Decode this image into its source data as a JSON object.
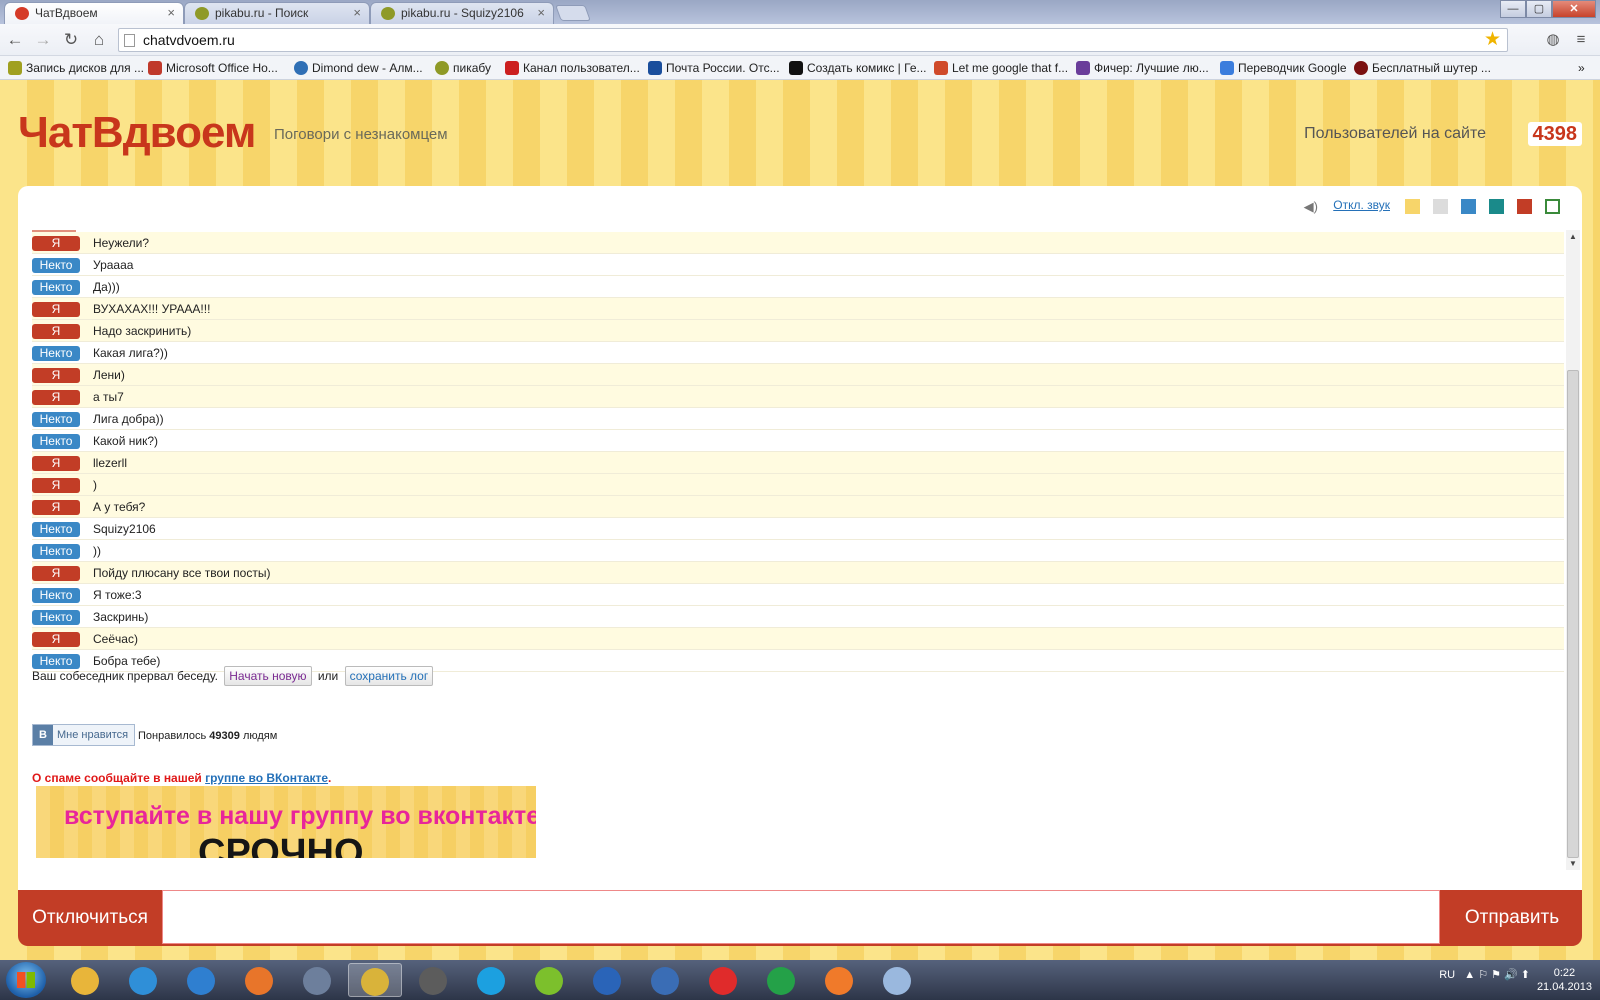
{
  "browser": {
    "tabs": [
      {
        "label": "ЧатВдвоем",
        "active": true,
        "favicon_color": "#d53b28"
      },
      {
        "label": "pikabu.ru - Поиск",
        "active": false,
        "favicon_color": "#8f9a27"
      },
      {
        "label": "pikabu.ru - Squizy2106",
        "active": false,
        "favicon_color": "#8f9a27"
      }
    ],
    "close_glyph": "×",
    "window_controls": {
      "minimize": "—",
      "maximize": "▢",
      "close": "✕"
    },
    "nav": {
      "back": "←",
      "forward": "→",
      "reload": "↻",
      "home": "⌂"
    },
    "address": "chatvdvoem.ru",
    "bookmarks": [
      {
        "label": "Запись дисков для ...",
        "icon_color": "#a0a020"
      },
      {
        "label": "Microsoft Office Но...",
        "icon_color": "#c0392b"
      },
      {
        "label": "Dimond dew - Алм...",
        "icon_color": "#2f6fb5"
      },
      {
        "label": "пикабу",
        "icon_color": "#8f9a27"
      },
      {
        "label": "Канал пользовател...",
        "icon_color": "#cc1f1f"
      },
      {
        "label": "Почта России. Отс...",
        "icon_color": "#1a4e9c"
      },
      {
        "label": "Создать комикс | Ге...",
        "icon_color": "#111111"
      },
      {
        "label": "Let me google that f...",
        "icon_color": "#d04a2a"
      },
      {
        "label": "Фичер: Лучшие лю...",
        "icon_color": "#6a3d9a"
      },
      {
        "label": "Переводчик Google",
        "icon_color": "#3b7ddd"
      },
      {
        "label": "Бесплатный шутер ...",
        "icon_color": "#7a1010"
      }
    ],
    "bookmarks_more": "»"
  },
  "site": {
    "logo": "ЧатВдвоем",
    "tagline": "Поговори с незнакомцем",
    "users_label": "Пользователей на сайте",
    "users_count": "4398",
    "sound_toggle": "Откл. звук",
    "theme_colors": [
      "#f7d56a",
      "#dcdcdc",
      "#3a88c6",
      "#1a8a8a",
      "#c23d26",
      "#3a8a3a"
    ],
    "accent": "#c23d26",
    "other_color": "#3a88c6"
  },
  "chat": {
    "me_label": "Я",
    "other_label": "Некто",
    "messages": [
      {
        "from": "me",
        "text": "Неужели?"
      },
      {
        "from": "other",
        "text": "Ураааа"
      },
      {
        "from": "other",
        "text": "Да)))"
      },
      {
        "from": "me",
        "text": "ВУХАХАХ!!! УРААА!!!"
      },
      {
        "from": "me",
        "text": "Надо заскринить)"
      },
      {
        "from": "other",
        "text": "Какая лига?))"
      },
      {
        "from": "me",
        "text": "Лени)"
      },
      {
        "from": "me",
        "text": "а ты7"
      },
      {
        "from": "other",
        "text": "Лига добра))"
      },
      {
        "from": "other",
        "text": "Какой ник?)"
      },
      {
        "from": "me",
        "text": "llezerll"
      },
      {
        "from": "me",
        "text": ")"
      },
      {
        "from": "me",
        "text": "А у тебя?"
      },
      {
        "from": "other",
        "text": "Squizy2106"
      },
      {
        "from": "other",
        "text": "))"
      },
      {
        "from": "me",
        "text": "Пойду плюсану все твои посты)"
      },
      {
        "from": "other",
        "text": "Я тоже:3"
      },
      {
        "from": "other",
        "text": "Заскринь)"
      },
      {
        "from": "me",
        "text": "Сеёчас)"
      },
      {
        "from": "other",
        "text": "Бобра тебе)"
      }
    ],
    "ended_text": "Ваш собеседник прервал беседу.",
    "new_chat_button": "Начать новую",
    "or_text": "или",
    "save_log_button": "сохранить лог"
  },
  "social": {
    "vk_logo": "В",
    "vk_like_button": "Мне нравится",
    "likes_prefix": "Понравилось",
    "likes_count": "49309",
    "likes_suffix": "людям",
    "spam_prefix": "О спаме сообщайте в нашей",
    "spam_link": "группе во ВКонтакте",
    "spam_suffix": "."
  },
  "banner": {
    "line1": "вступайте в нашу группу во вконтакте",
    "line2": "СРОЧНО"
  },
  "compose": {
    "disconnect_button": "Отключиться",
    "input_value": "",
    "send_button": "Отправить"
  },
  "taskbar": {
    "apps": [
      {
        "name": "explorer",
        "color": "#e8b53a"
      },
      {
        "name": "safari",
        "color": "#2f8fd8"
      },
      {
        "name": "ie",
        "color": "#2f7fd0"
      },
      {
        "name": "firefox",
        "color": "#e8752a"
      },
      {
        "name": "game",
        "color": "#6d7f9c"
      },
      {
        "name": "chrome",
        "color": "#d9b33a"
      },
      {
        "name": "wot",
        "color": "#5c5c5c"
      },
      {
        "name": "skype",
        "color": "#1ca0e0"
      },
      {
        "name": "app-green",
        "color": "#7cc02c"
      },
      {
        "name": "app-blue",
        "color": "#2a64b8"
      },
      {
        "name": "app-k",
        "color": "#3a6db5"
      },
      {
        "name": "yandex",
        "color": "#e02b2b"
      },
      {
        "name": "mail-agent",
        "color": "#24a148"
      },
      {
        "name": "origin",
        "color": "#f07a2a"
      },
      {
        "name": "paint",
        "color": "#9ab8de"
      }
    ],
    "language": "RU",
    "tray_icons": "▲ ⚐ ⚑ 🔊 ⬆",
    "time": "0:22",
    "date": "21.04.2013"
  }
}
